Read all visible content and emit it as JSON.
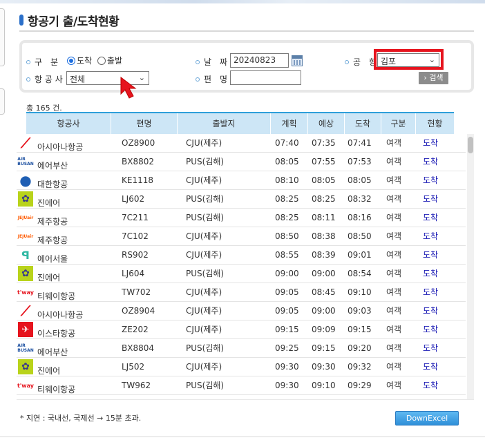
{
  "page": {
    "title": "항공기 출/도착현황"
  },
  "search": {
    "type_label": "구　분",
    "type_options": [
      {
        "label": "도착",
        "checked": true
      },
      {
        "label": "출발",
        "checked": false
      }
    ],
    "date_label": "날　짜",
    "date_value": "20240823",
    "airport_label": "공　항",
    "airport_value": "김포",
    "airline_label": "항 공 사",
    "airline_value": "전체",
    "flight_label": "편　명",
    "flight_value": "",
    "search_button": "› 검색"
  },
  "result": {
    "count_text": "총 165 건."
  },
  "table": {
    "columns": [
      "항공사",
      "편명",
      "출발지",
      "계획",
      "예상",
      "도착",
      "구분",
      "현황"
    ],
    "rows": [
      {
        "airline": "아시아나항공",
        "logo": "asiana-logo",
        "flight": "OZ8900",
        "origin": "CJU(제주)",
        "planned": "07:40",
        "expected": "07:35",
        "arrival": "07:41",
        "type": "여객",
        "status": "도착"
      },
      {
        "airline": "에어부산",
        "logo": "airbusan-logo",
        "flight": "BX8802",
        "origin": "PUS(김해)",
        "planned": "08:05",
        "expected": "07:55",
        "arrival": "07:53",
        "type": "여객",
        "status": "도착"
      },
      {
        "airline": "대한항공",
        "logo": "koreanair-logo",
        "flight": "KE1118",
        "origin": "CJU(제주)",
        "planned": "08:10",
        "expected": "08:05",
        "arrival": "08:05",
        "type": "여객",
        "status": "도착"
      },
      {
        "airline": "진에어",
        "logo": "jinair-logo",
        "flight": "LJ602",
        "origin": "PUS(김해)",
        "planned": "08:25",
        "expected": "08:25",
        "arrival": "08:32",
        "type": "여객",
        "status": "도착"
      },
      {
        "airline": "제주항공",
        "logo": "jejuair-logo",
        "flight": "7C211",
        "origin": "PUS(김해)",
        "planned": "08:25",
        "expected": "08:11",
        "arrival": "08:16",
        "type": "여객",
        "status": "도착"
      },
      {
        "airline": "제주항공",
        "logo": "jejuair-logo",
        "flight": "7C102",
        "origin": "CJU(제주)",
        "planned": "08:50",
        "expected": "08:38",
        "arrival": "08:50",
        "type": "여객",
        "status": "도착"
      },
      {
        "airline": "에어서울",
        "logo": "airseoul-logo",
        "flight": "RS902",
        "origin": "CJU(제주)",
        "planned": "08:55",
        "expected": "08:39",
        "arrival": "09:01",
        "type": "여객",
        "status": "도착"
      },
      {
        "airline": "진에어",
        "logo": "jinair-logo",
        "flight": "LJ604",
        "origin": "PUS(김해)",
        "planned": "09:00",
        "expected": "09:00",
        "arrival": "08:54",
        "type": "여객",
        "status": "도착"
      },
      {
        "airline": "티웨이항공",
        "logo": "tway-logo",
        "flight": "TW702",
        "origin": "CJU(제주)",
        "planned": "09:05",
        "expected": "08:45",
        "arrival": "09:10",
        "type": "여객",
        "status": "도착"
      },
      {
        "airline": "아시아나항공",
        "logo": "asiana-logo",
        "flight": "OZ8904",
        "origin": "CJU(제주)",
        "planned": "09:05",
        "expected": "09:00",
        "arrival": "09:03",
        "type": "여객",
        "status": "도착"
      },
      {
        "airline": "이스타항공",
        "logo": "eastarjet-logo",
        "flight": "ZE202",
        "origin": "CJU(제주)",
        "planned": "09:15",
        "expected": "09:09",
        "arrival": "09:15",
        "type": "여객",
        "status": "도착"
      },
      {
        "airline": "에어부산",
        "logo": "airbusan-logo",
        "flight": "BX8804",
        "origin": "PUS(김해)",
        "planned": "09:25",
        "expected": "09:15",
        "arrival": "09:20",
        "type": "여객",
        "status": "도착"
      },
      {
        "airline": "진에어",
        "logo": "jinair-logo",
        "flight": "LJ502",
        "origin": "CJU(제주)",
        "planned": "09:30",
        "expected": "09:30",
        "arrival": "09:32",
        "type": "여객",
        "status": "도착"
      },
      {
        "airline": "티웨이항공",
        "logo": "tway-logo",
        "flight": "TW962",
        "origin": "PUS(김해)",
        "planned": "09:30",
        "expected": "09:10",
        "arrival": "09:29",
        "type": "여객",
        "status": "도착"
      }
    ]
  },
  "footer": {
    "note": "* 지연 : 국내선, 국제선 → 15분 초과.",
    "excel_button": "DownExcel"
  },
  "colors": {
    "accent": "#2e9fda",
    "highlight": "#e6141e",
    "status_link": "#1a1ab4"
  }
}
